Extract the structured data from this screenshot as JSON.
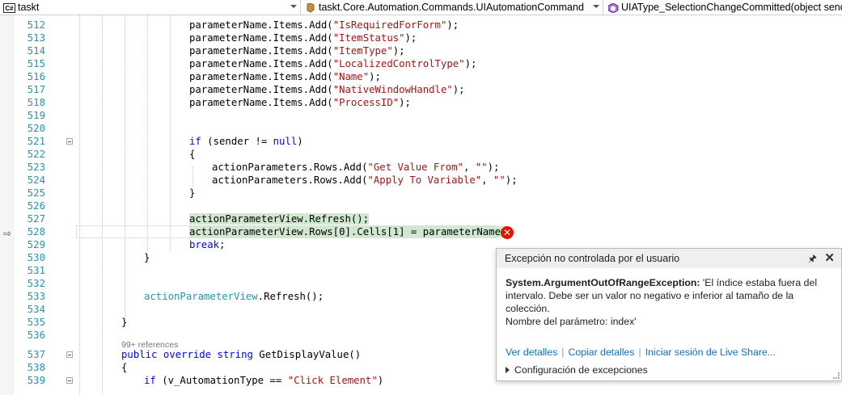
{
  "navbar": {
    "project": {
      "badge": "C#",
      "label": "taskt"
    },
    "class": {
      "label": "taskt.Core.Automation.Commands.UIAutomationCommand"
    },
    "member": {
      "label": "UIAType_SelectionChangeCommitted(object sender"
    }
  },
  "references": "99+ references",
  "lines": [
    {
      "n": "512",
      "indent": 140,
      "tokens": [
        [
          "",
          "parameterName.Items.Add("
        ],
        [
          "str",
          "\"IsRequiredForForm\""
        ],
        [
          "",
          ");"
        ]
      ]
    },
    {
      "n": "513",
      "indent": 140,
      "tokens": [
        [
          "",
          "parameterName.Items.Add("
        ],
        [
          "str",
          "\"ItemStatus\""
        ],
        [
          "",
          ");"
        ]
      ]
    },
    {
      "n": "514",
      "indent": 140,
      "tokens": [
        [
          "",
          "parameterName.Items.Add("
        ],
        [
          "str",
          "\"ItemType\""
        ],
        [
          "",
          ");"
        ]
      ]
    },
    {
      "n": "515",
      "indent": 140,
      "tokens": [
        [
          "",
          "parameterName.Items.Add("
        ],
        [
          "str",
          "\"LocalizedControlType\""
        ],
        [
          "",
          ");"
        ]
      ]
    },
    {
      "n": "516",
      "indent": 140,
      "tokens": [
        [
          "",
          "parameterName.Items.Add("
        ],
        [
          "str",
          "\"Name\""
        ],
        [
          "",
          ");"
        ]
      ]
    },
    {
      "n": "517",
      "indent": 140,
      "tokens": [
        [
          "",
          "parameterName.Items.Add("
        ],
        [
          "str",
          "\"NativeWindowHandle\""
        ],
        [
          "",
          ");"
        ]
      ]
    },
    {
      "n": "518",
      "indent": 140,
      "tokens": [
        [
          "",
          "parameterName.Items.Add("
        ],
        [
          "str",
          "\"ProcessID\""
        ],
        [
          "",
          ");"
        ]
      ]
    },
    {
      "n": "519",
      "indent": 0,
      "tokens": []
    },
    {
      "n": "520",
      "indent": 0,
      "tokens": []
    },
    {
      "n": "521",
      "indent": 140,
      "fold": true,
      "tokens": [
        [
          "kw",
          "if"
        ],
        [
          "",
          " (sender != "
        ],
        [
          "kw",
          "null"
        ],
        [
          "",
          ")"
        ]
      ]
    },
    {
      "n": "522",
      "indent": 140,
      "tokens": [
        [
          "",
          "{"
        ]
      ]
    },
    {
      "n": "523",
      "indent": 168,
      "tokens": [
        [
          "",
          "actionParameters.Rows.Add("
        ],
        [
          "str",
          "\"Get Value From\""
        ],
        [
          "",
          ", "
        ],
        [
          "str",
          "\"\""
        ],
        [
          "",
          ");"
        ]
      ]
    },
    {
      "n": "524",
      "indent": 168,
      "tokens": [
        [
          "",
          "actionParameters.Rows.Add("
        ],
        [
          "str",
          "\"Apply To Variable\""
        ],
        [
          "",
          ", "
        ],
        [
          "str",
          "\"\""
        ],
        [
          "",
          ");"
        ]
      ]
    },
    {
      "n": "525",
      "indent": 140,
      "tokens": [
        [
          "",
          "}"
        ]
      ]
    },
    {
      "n": "526",
      "indent": 0,
      "tokens": []
    },
    {
      "n": "527",
      "indent": 140,
      "tokens": [
        [
          "hl",
          "actionParameterView.Refresh();"
        ]
      ]
    },
    {
      "n": "528",
      "indent": 140,
      "current": true,
      "tokens": [
        [
          "hl",
          "actionParameterView.Rows[0].Cells[1] = parameterName;"
        ]
      ]
    },
    {
      "n": "529",
      "indent": 140,
      "tokens": [
        [
          "kw",
          "break"
        ],
        [
          "",
          ";"
        ]
      ]
    },
    {
      "n": "530",
      "indent": 84,
      "tokens": [
        [
          "",
          "}"
        ]
      ]
    },
    {
      "n": "531",
      "indent": 0,
      "tokens": []
    },
    {
      "n": "532",
      "indent": 0,
      "tokens": []
    },
    {
      "n": "533",
      "indent": 84,
      "tokens": [
        [
          "ty",
          "actionParameterView"
        ],
        [
          "",
          ".Refresh();"
        ]
      ]
    },
    {
      "n": "534",
      "indent": 0,
      "tokens": []
    },
    {
      "n": "535",
      "indent": 56,
      "tokens": [
        [
          "",
          "}"
        ]
      ]
    },
    {
      "n": "536",
      "indent": 0,
      "tokens": []
    },
    {
      "n": "537",
      "indent": 56,
      "fold": true,
      "tokens": [
        [
          "kw",
          "public"
        ],
        [
          "",
          " "
        ],
        [
          "kw",
          "override"
        ],
        [
          "",
          " "
        ],
        [
          "kw",
          "string"
        ],
        [
          "",
          " GetDisplayValue()"
        ]
      ]
    },
    {
      "n": "538",
      "indent": 56,
      "tokens": [
        [
          "",
          "{"
        ]
      ]
    },
    {
      "n": "539",
      "indent": 84,
      "fold": true,
      "tokens": [
        [
          "kw",
          "if"
        ],
        [
          "",
          " (v_AutomationType == "
        ],
        [
          "str",
          "\"Click Element\""
        ],
        [
          "",
          ")"
        ]
      ]
    }
  ],
  "exception": {
    "title": "Excepción no controlada por el usuario",
    "type": "System.ArgumentOutOfRangeException:",
    "message": " 'El índice estaba fuera del intervalo. Debe ser un valor no negativo e inferior al tamaño de la colección.",
    "param": "Nombre del parámetro: index'",
    "links": [
      "Ver detalles",
      "Copiar detalles",
      "Iniciar sesión de Live Share..."
    ],
    "config": "Configuración de excepciones"
  }
}
